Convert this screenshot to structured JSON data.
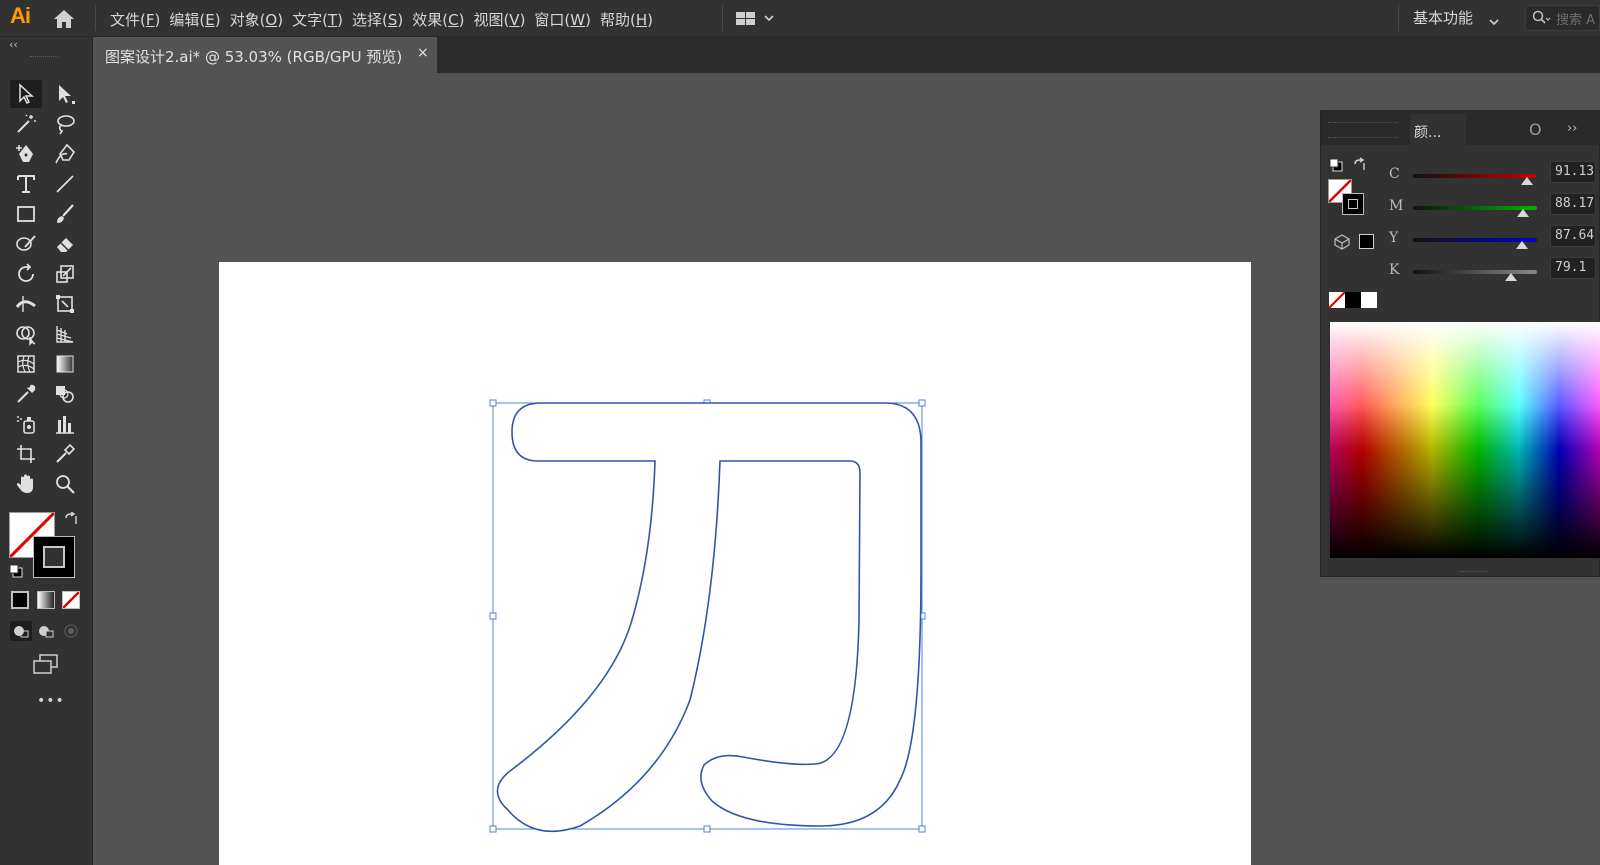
{
  "app": {
    "logo": "Ai"
  },
  "menu": [
    {
      "label": "文件(",
      "acc": "F",
      "end": ")"
    },
    {
      "label": "编辑(",
      "acc": "E",
      "end": ")"
    },
    {
      "label": "对象(",
      "acc": "O",
      "end": ")"
    },
    {
      "label": "文字(",
      "acc": "T",
      "end": ")"
    },
    {
      "label": "选择(",
      "acc": "S",
      "end": ")"
    },
    {
      "label": "效果(",
      "acc": "C",
      "end": ")"
    },
    {
      "label": "视图(",
      "acc": "V",
      "end": ")"
    },
    {
      "label": "窗口(",
      "acc": "W",
      "end": ")"
    },
    {
      "label": "帮助(",
      "acc": "H",
      "end": ")"
    }
  ],
  "workspace": {
    "label": "基本功能"
  },
  "search": {
    "placeholder": "搜索 A"
  },
  "document_tab": {
    "title": "图案设计2.ai* @ 53.03% (RGB/GPU 预览)",
    "close": "×"
  },
  "toolbar": {
    "collapse": "‹‹",
    "more": "•••"
  },
  "color_panel": {
    "tab_label": "颜...",
    "second_tab": "O",
    "expand": "››",
    "sliders": [
      {
        "label": "C",
        "value": "91.13",
        "level": 0.92,
        "color": "#c80000"
      },
      {
        "label": "M",
        "value": "88.17",
        "level": 0.89,
        "color": "#00b400"
      },
      {
        "label": "Y",
        "value": "87.64",
        "level": 0.88,
        "color": "#0000c8"
      },
      {
        "label": "K",
        "value": "79.1",
        "level": 0.79,
        "color": "#8c8c8c"
      }
    ]
  },
  "colors": {
    "path_stroke": "#3355a8",
    "selection": "#4a86e8"
  }
}
